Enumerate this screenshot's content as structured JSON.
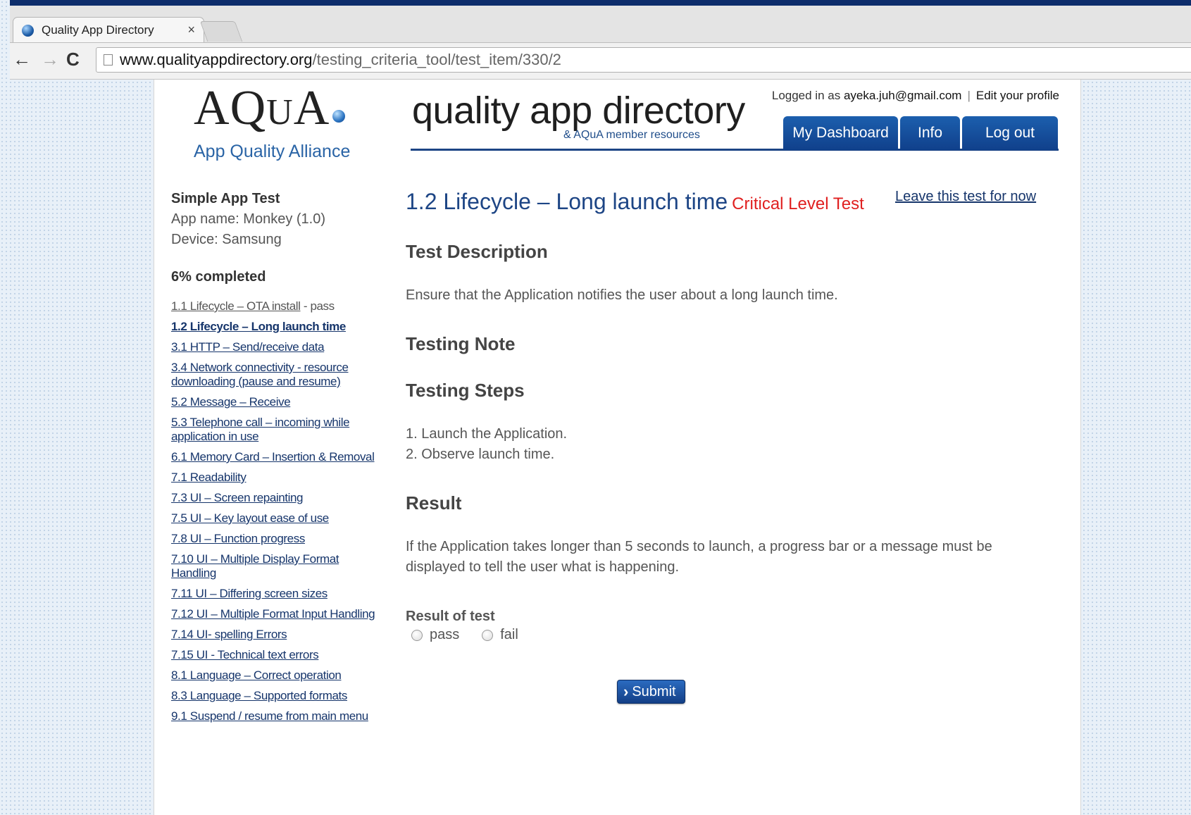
{
  "browser": {
    "tab_title": "Quality App Directory",
    "tab_close": "×",
    "url_host": "www.qualityappdirectory.org",
    "url_path": "/testing_criteria_tool/test_item/330/2"
  },
  "header": {
    "logo_word_a": "A",
    "logo_word_q": "Q",
    "logo_word_u": "U",
    "logo_word_a2": "A",
    "logo_subtitle": "App Quality Alliance",
    "brand_title": "quality app directory",
    "brand_subtitle": "& AQuA member resources",
    "logged_in_prefix": "Logged in as ",
    "user_email": "ayeka.juh@gmail.com",
    "separator": "|",
    "edit_profile": "Edit your profile",
    "nav": [
      "My Dashboard",
      "Info",
      "Log out"
    ]
  },
  "sidebar": {
    "test_name": "Simple App Test",
    "app_name": "App name: Monkey (1.0)",
    "device": "Device: Samsung",
    "progress": "6% completed",
    "items": [
      {
        "label": "1.1 Lifecycle – OTA install",
        "status": " - pass"
      },
      {
        "label": "1.2 Lifecycle – Long launch time",
        "status": ""
      },
      {
        "label": "3.1 HTTP – Send/receive data",
        "status": ""
      },
      {
        "label": "3.4 Network connectivity - resource downloading (pause and resume)",
        "status": ""
      },
      {
        "label": "5.2 Message – Receive",
        "status": ""
      },
      {
        "label": "5.3 Telephone call – incoming while application in use",
        "status": ""
      },
      {
        "label": "6.1 Memory Card – Insertion & Removal",
        "status": ""
      },
      {
        "label": "7.1 Readability",
        "status": ""
      },
      {
        "label": "7.3 UI – Screen repainting",
        "status": ""
      },
      {
        "label": "7.5 UI – Key layout ease of use",
        "status": ""
      },
      {
        "label": "7.8 UI – Function progress",
        "status": ""
      },
      {
        "label": "7.10 UI – Multiple Display Format Handling",
        "status": ""
      },
      {
        "label": "7.11 UI – Differing screen sizes",
        "status": ""
      },
      {
        "label": "7.12 UI – Multiple Format Input Handling",
        "status": ""
      },
      {
        "label": "7.14 UI- spelling Errors",
        "status": ""
      },
      {
        "label": "7.15 UI - Technical text errors",
        "status": ""
      },
      {
        "label": "8.1 Language – Correct operation",
        "status": ""
      },
      {
        "label": "8.3 Language – Supported formats",
        "status": ""
      },
      {
        "label": "9.1 Suspend / resume from main menu",
        "status": ""
      }
    ]
  },
  "main": {
    "title": "1.2 Lifecycle – Long launch time",
    "level": "Critical Level Test",
    "leave_link": "Leave this test for now",
    "description_heading": "Test Description",
    "description": "Ensure that the Application notifies the user about a long launch time.",
    "note_heading": "Testing Note",
    "steps_heading": "Testing Steps",
    "steps": [
      "1. Launch the Application.",
      "2. Observe launch time."
    ],
    "result_heading": "Result",
    "result_text": "If the Application takes longer than 5 seconds to launch, a progress bar or a message must be displayed to tell the user what is happening.",
    "result_of_test_label": "Result of test",
    "options": [
      "pass",
      "fail"
    ],
    "submit_label": "Submit"
  },
  "colors": {
    "brand_blue": "#1d4585",
    "critical_red": "#e02020",
    "nav_blue": "#1c5fae"
  },
  "icons": {
    "favicon": "aqua-globe-icon",
    "back": "back-arrow-icon",
    "forward": "forward-arrow-icon",
    "reload": "reload-icon",
    "page": "page-icon",
    "submit": "chevron-right-icon"
  }
}
